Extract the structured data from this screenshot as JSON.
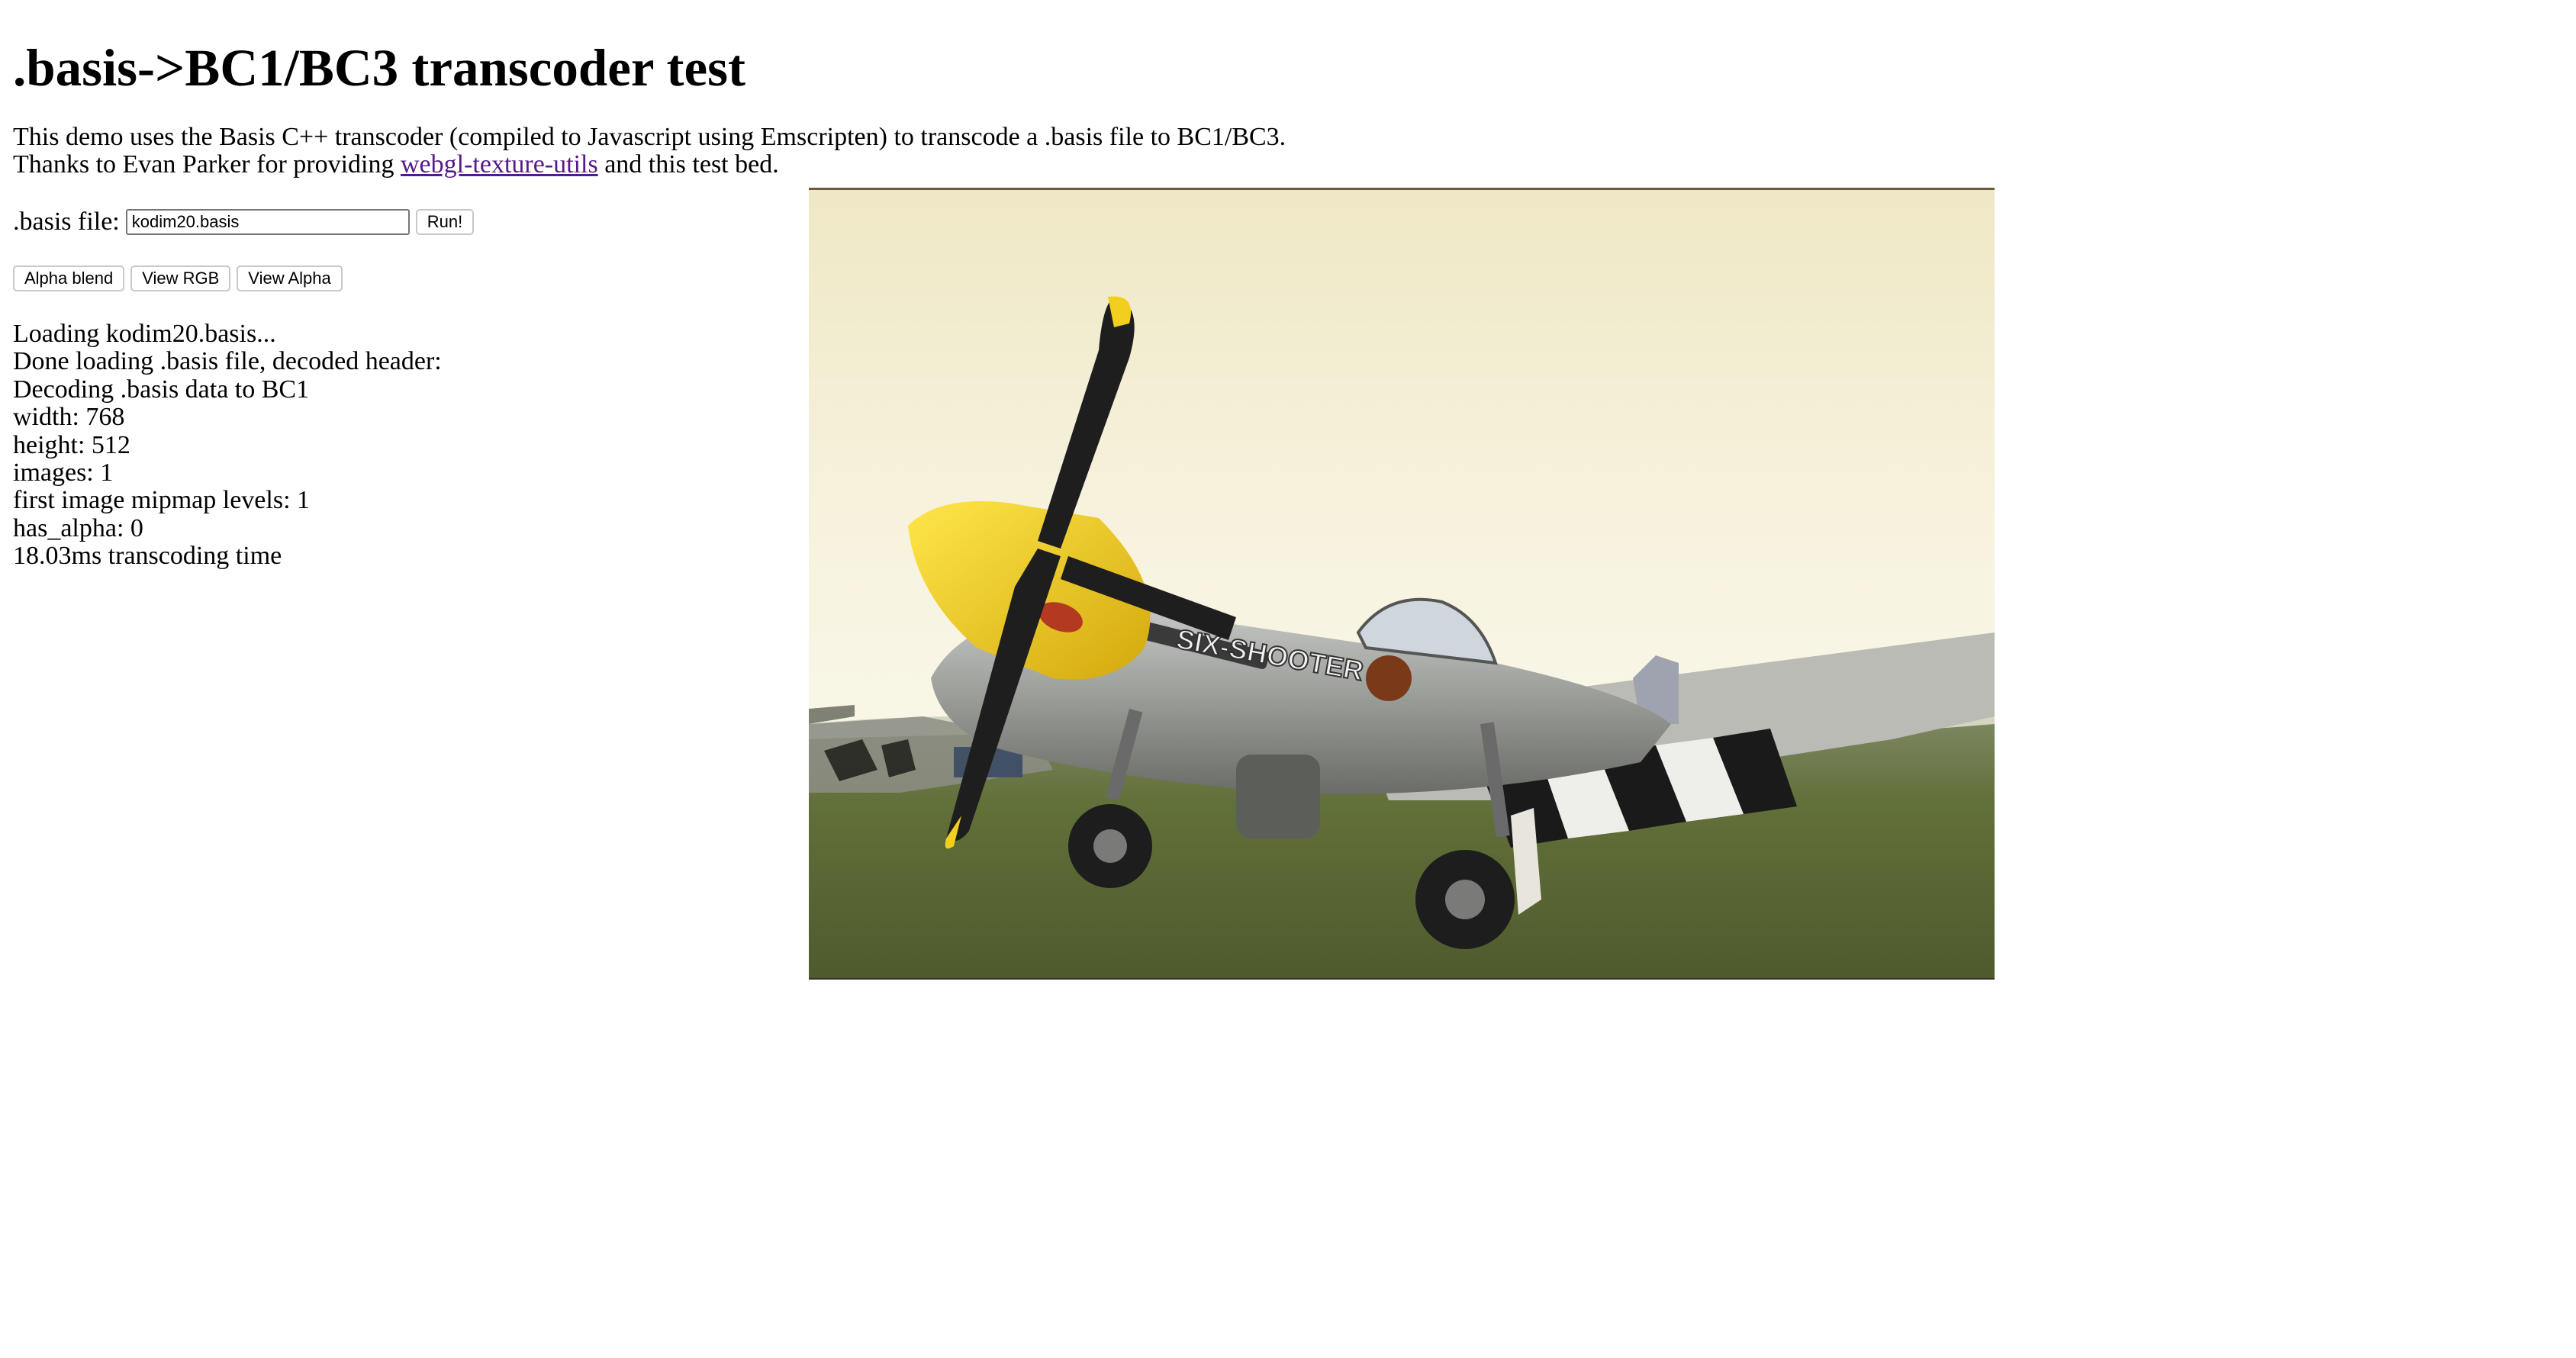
{
  "page": {
    "title": ".basis->BC1/BC3 transcoder test",
    "intro_line1": "This demo uses the Basis C++ transcoder (compiled to Javascript using Emscripten) to transcode a .basis file to BC1/BC3.",
    "intro_line2_prefix": "Thanks to Evan Parker for providing ",
    "intro_link": "webgl-texture-utils",
    "intro_line2_suffix": " and this test bed."
  },
  "controls": {
    "file_label": ".basis file:",
    "file_value": "kodim20.basis",
    "run_label": "Run!",
    "alpha_blend_label": "Alpha blend",
    "view_rgb_label": "View RGB",
    "view_alpha_label": "View Alpha"
  },
  "log": [
    "Loading kodim20.basis...",
    "Done loading .basis file, decoded header:",
    "Decoding .basis data to BC1",
    "width: 768",
    "height: 512",
    "images: 1",
    "first image mipmap levels: 1",
    "has_alpha: 0",
    "18.03ms transcoding time"
  ],
  "image": {
    "subject": "P-51 Mustang aircraft \"Six-Shooter\" parked on grass",
    "nose_text": "SIX-SHOOTER",
    "colors": {
      "sky_top": "#f3efd2",
      "sky_bottom": "#fbf9ef",
      "grass": "#5f6b3a",
      "fuselage": "#9a9c98",
      "nose": "#f2cf1c"
    }
  }
}
